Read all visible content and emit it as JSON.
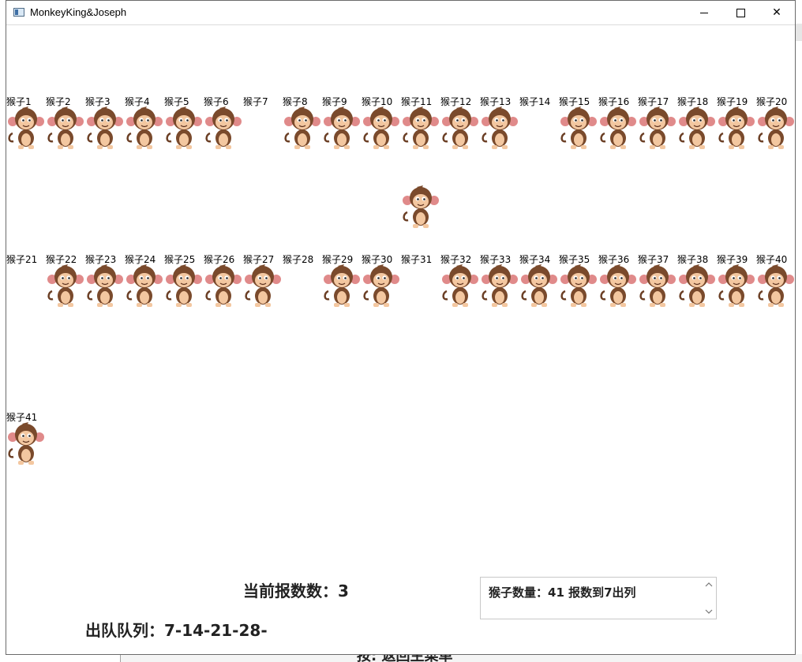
{
  "window": {
    "title": "MonkeyKing&Joseph"
  },
  "monkeys": [
    {
      "label": "猴子1",
      "visible": true
    },
    {
      "label": "猴子2",
      "visible": true
    },
    {
      "label": "猴子3",
      "visible": true
    },
    {
      "label": "猴子4",
      "visible": true
    },
    {
      "label": "猴子5",
      "visible": true
    },
    {
      "label": "猴子6",
      "visible": true
    },
    {
      "label": "猴子7",
      "visible": false
    },
    {
      "label": "猴子8",
      "visible": true
    },
    {
      "label": "猴子9",
      "visible": true
    },
    {
      "label": "猴子10",
      "visible": true
    },
    {
      "label": "猴子11",
      "visible": true
    },
    {
      "label": "猴子12",
      "visible": true
    },
    {
      "label": "猴子13",
      "visible": true
    },
    {
      "label": "猴子14",
      "visible": false
    },
    {
      "label": "猴子15",
      "visible": true
    },
    {
      "label": "猴子16",
      "visible": true
    },
    {
      "label": "猴子17",
      "visible": true
    },
    {
      "label": "猴子18",
      "visible": true
    },
    {
      "label": "猴子19",
      "visible": true
    },
    {
      "label": "猴子20",
      "visible": true
    },
    {
      "label": "猴子21",
      "visible": false
    },
    {
      "label": "猴子22",
      "visible": true
    },
    {
      "label": "猴子23",
      "visible": true
    },
    {
      "label": "猴子24",
      "visible": true
    },
    {
      "label": "猴子25",
      "visible": true
    },
    {
      "label": "猴子26",
      "visible": true
    },
    {
      "label": "猴子27",
      "visible": true
    },
    {
      "label": "猴子28",
      "visible": false
    },
    {
      "label": "猴子29",
      "visible": true
    },
    {
      "label": "猴子30",
      "visible": true
    },
    {
      "label": "猴子31",
      "visible": false
    },
    {
      "label": "猴子32",
      "visible": true
    },
    {
      "label": "猴子33",
      "visible": true
    },
    {
      "label": "猴子34",
      "visible": true
    },
    {
      "label": "猴子35",
      "visible": true
    },
    {
      "label": "猴子36",
      "visible": true
    },
    {
      "label": "猴子37",
      "visible": true
    },
    {
      "label": "猴子38",
      "visible": true
    },
    {
      "label": "猴子39",
      "visible": true
    },
    {
      "label": "猴子40",
      "visible": true
    },
    {
      "label": "猴子41",
      "visible": true
    }
  ],
  "status": {
    "current_count": "当前报数数：3",
    "out_queue": "出队队列：7-14-21-28-"
  },
  "info": {
    "text": "猴子数量：41  报数到7出列"
  },
  "background": {
    "partial_text": "按: 返回主菜单"
  },
  "icons": [
    "window-app-icon",
    "minimize-icon",
    "maximize-icon",
    "close-icon",
    "monkey-icon",
    "scroll-up-icon",
    "scroll-down-icon"
  ]
}
